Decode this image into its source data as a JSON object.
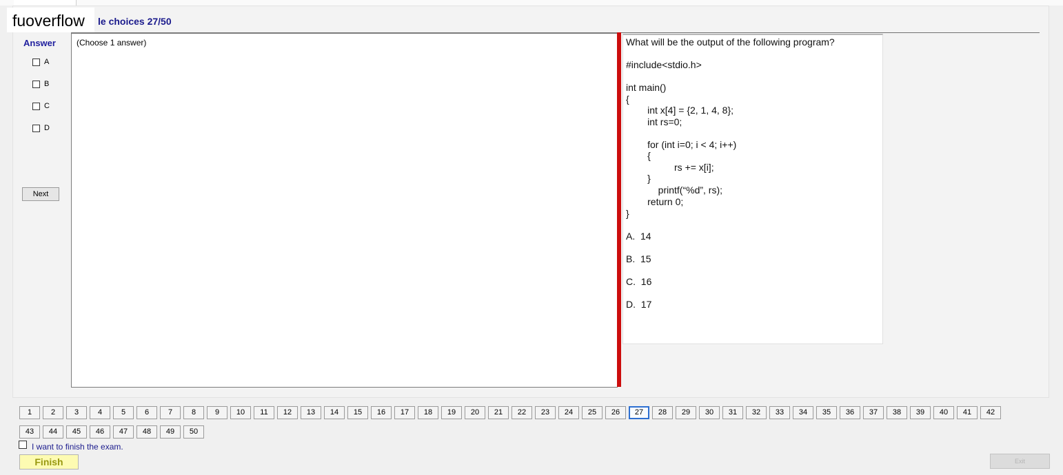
{
  "watermark": "fuoverflow",
  "section_title": "le choices 27/50",
  "answer": {
    "label": "Answer",
    "options": [
      "A",
      "B",
      "C",
      "D"
    ],
    "next_label": "Next"
  },
  "choose_hint": "(Choose 1 answer)",
  "question": {
    "lines": [
      "What will be the output of the following program?",
      "#include<stdio.h>",
      "int main()",
      "{",
      "        int x[4] = {2, 1, 4, 8};",
      "        int rs=0;",
      "        for (int i=0; i < 4; i++)",
      "        {",
      "                  rs += x[i];",
      "        }",
      "            printf(“%d”, rs);",
      "        return 0;",
      "}",
      "A.  14",
      "B.  15",
      "C.  16",
      "D.  17"
    ]
  },
  "navigation": {
    "questions": [
      "1",
      "2",
      "3",
      "4",
      "5",
      "6",
      "7",
      "8",
      "9",
      "10",
      "11",
      "12",
      "13",
      "14",
      "15",
      "16",
      "17",
      "18",
      "19",
      "20",
      "21",
      "22",
      "23",
      "24",
      "25",
      "26",
      "27",
      "28",
      "29",
      "30",
      "31",
      "32",
      "33",
      "34",
      "35",
      "36",
      "37",
      "38",
      "39",
      "40",
      "41",
      "42",
      "43",
      "44",
      "45",
      "46",
      "47",
      "48",
      "49",
      "50"
    ],
    "current": "27"
  },
  "footer": {
    "finish_check_label": "I want to finish the exam.",
    "finish_button": "Finish",
    "exit_button": "Exit"
  },
  "colors": {
    "title": "#1a1a8c",
    "splitter": "#cc0d0d",
    "finish_bg": "#fdfbb2",
    "current_border": "#2d6fd1"
  }
}
